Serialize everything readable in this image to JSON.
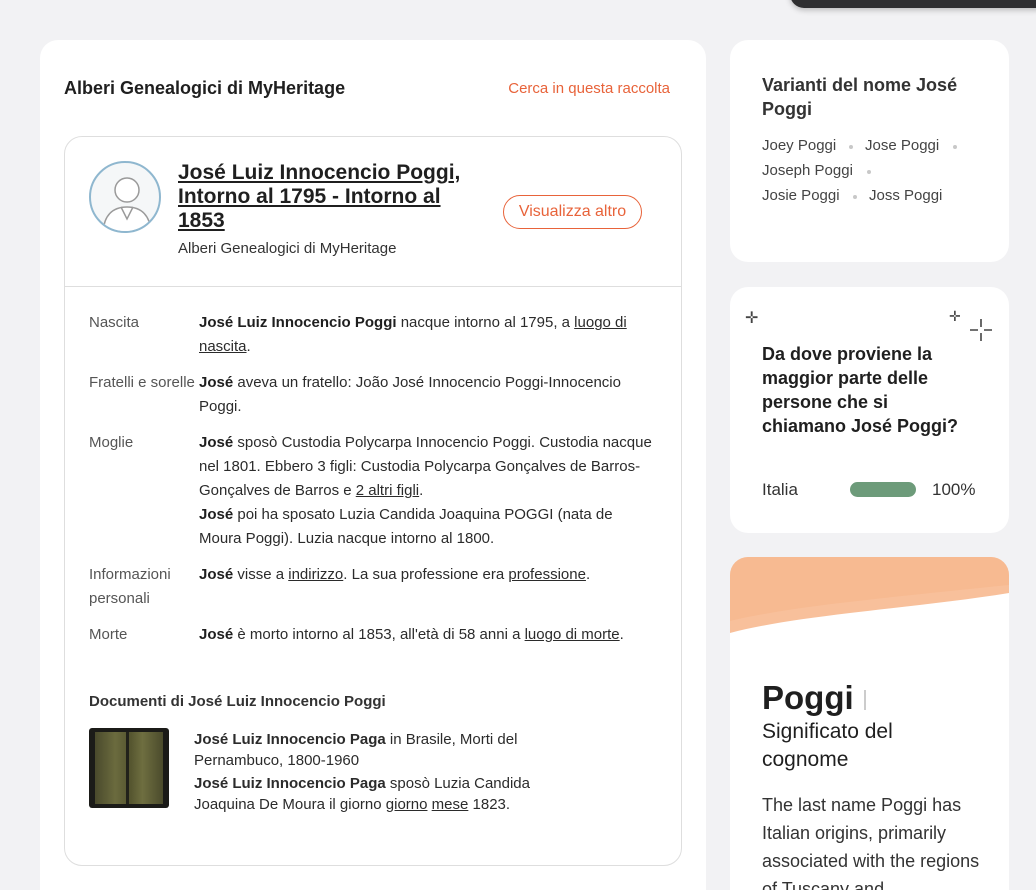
{
  "main": {
    "title": "Alberi Genealogici di MyHeritage",
    "search_link": "Cerca in questa raccolta"
  },
  "record": {
    "name": "José Luiz Innocencio Poggi, Intorno al 1795 - Intorno al 1853",
    "source": "Alberi Genealogici di MyHeritage",
    "view_more": "Visualizza altro",
    "facts": [
      {
        "label": "Nascita",
        "bold": "José Luiz Innocencio Poggi",
        "text": " nacque intorno al 1795, a ",
        "link": "luogo di nascita",
        "tail": "."
      },
      {
        "label": "Fratelli e sorelle",
        "bold": "José",
        "text": " aveva un fratello: João José Innocencio Poggi-Innocencio Poggi.",
        "link": "",
        "tail": ""
      },
      {
        "label": "Moglie",
        "bold": "José",
        "text": " sposò Custodia Polycarpa Innocencio Poggi. Custodia nacque nel 1801. Ebbero 3 figli: Custodia Polycarpa Gonçalves de Barros-Gonçalves de Barros e ",
        "link": "2 altri figli",
        "tail": ".",
        "bold2": "José",
        "text2": " poi ha sposato Luzia Candida Joaquina POGGI (nata de Moura Poggi). Luzia nacque intorno al 1800."
      },
      {
        "label": "Informazioni personali",
        "bold": "José",
        "text": " visse a ",
        "link": "indirizzo",
        "text_b": ". La sua professione era ",
        "link2": "professione",
        "tail": "."
      },
      {
        "label": "Morte",
        "bold": "José",
        "text": " è morto intorno al 1853, all'età di 58 anni a ",
        "link": "luogo di morte",
        "tail": "."
      }
    ]
  },
  "documents": {
    "title": "Documenti di José Luiz Innocencio Poggi",
    "line1_bold": "José Luiz Innocencio Paga",
    "line1_text": " in Brasile, Morti del Pernambuco, 1800-1960",
    "line2_bold": "José Luiz Innocencio Paga",
    "line2_text": " sposò Luzia Candida Joaquina De Moura il giorno ",
    "line2_link1": "giorno",
    "line2_link2": "mese",
    "line2_tail": " 1823."
  },
  "variants": {
    "title": "Varianti del nome José Poggi",
    "items": [
      "Joey Poggi",
      "Jose Poggi",
      "Joseph Poggi",
      "Josie Poggi",
      "Joss Poggi"
    ]
  },
  "origin": {
    "question": "Da dove proviene la maggior parte delle persone che si chiamano José Poggi?",
    "country": "Italia",
    "percent_label": "100%",
    "percent_value": 100,
    "bar_color": "#6d9b7a"
  },
  "meaning": {
    "surname": "Poggi",
    "subtitle": "Significato del cognome",
    "body": "The last name Poggi has Italian origins, primarily associated with the regions of Tuscany and"
  },
  "colors": {
    "accent": "#e8633a",
    "wave": "#f7b58a"
  }
}
